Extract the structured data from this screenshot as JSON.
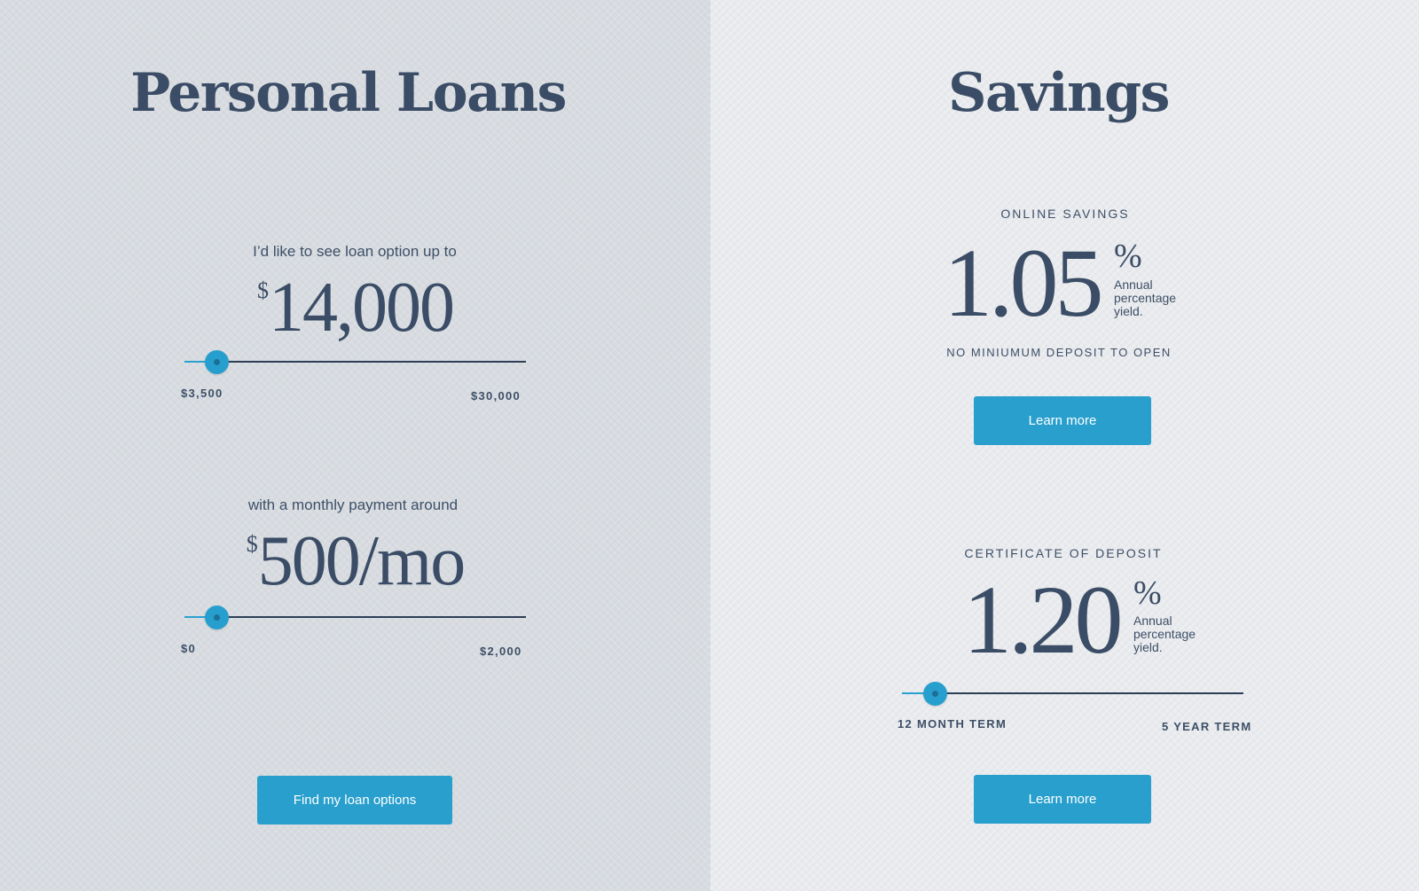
{
  "loans": {
    "title": "Personal Loans",
    "amount": {
      "prompt": "I’d like to see loan option up to",
      "currency": "$",
      "value": "14,000",
      "min_label": "$3,500",
      "max_label": "$30,000",
      "position": 0.1
    },
    "payment": {
      "prompt": "with a monthly payment around",
      "currency": "$",
      "value": "500/mo",
      "min_label": "$0",
      "max_label": "$2,000",
      "position": 0.1
    },
    "button_label": "Find my loan options"
  },
  "savings": {
    "title": "Savings",
    "online": {
      "label": "ONLINE SAVINGS",
      "rate": "1.05",
      "percent": "%",
      "apy_text": "Annual percentage yield.",
      "note": "NO MINIUMUM DEPOSIT TO OPEN",
      "button_label": "Learn more"
    },
    "cd": {
      "label": "CERTIFICATE OF DEPOSIT",
      "rate": "1.20",
      "percent": "%",
      "apy_text": "Annual percentage yield.",
      "min_label": "12 MONTH TERM",
      "max_label": "5 YEAR TERM",
      "position": 0.1,
      "button_label": "Learn more"
    }
  },
  "colors": {
    "accent": "#289fcd",
    "text": "#3b4d66",
    "left_bg": "#d8dce1",
    "right_bg": "#e8eaed"
  }
}
